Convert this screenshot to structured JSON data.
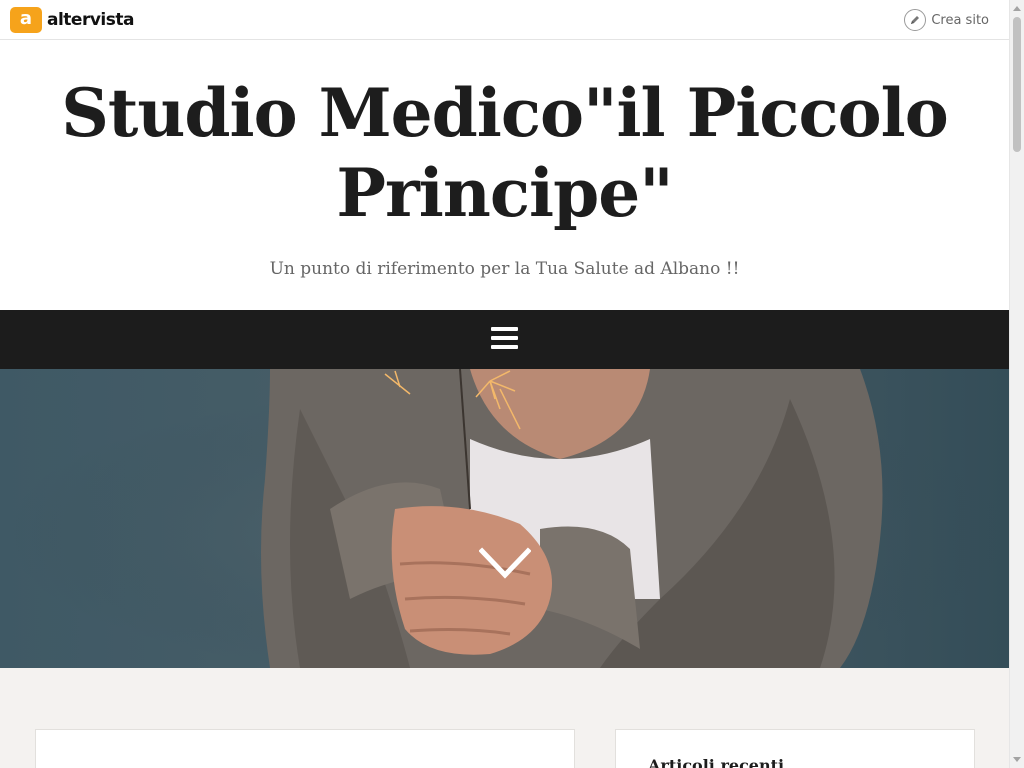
{
  "topbar": {
    "logo_letter": "a",
    "logo_text": "altervista",
    "crea_label": "Crea sito",
    "crea_icon": "pencil-icon"
  },
  "header": {
    "title": "Studio Medico\"il Piccolo Principe\"",
    "description": "Un punto di riferimento per la Tua Salute ad Albano !!"
  },
  "nav": {
    "menu_icon": "hamburger-menu-icon"
  },
  "hero": {
    "scroll_icon": "chevron-down-icon"
  },
  "sidebar": {
    "widget_title": "Articoli recenti"
  },
  "colors": {
    "brand_orange": "#f6a31b",
    "nav_bg": "#1c1c1c",
    "page_bg": "#f4f2f0",
    "title_color": "#1d1d1d"
  }
}
